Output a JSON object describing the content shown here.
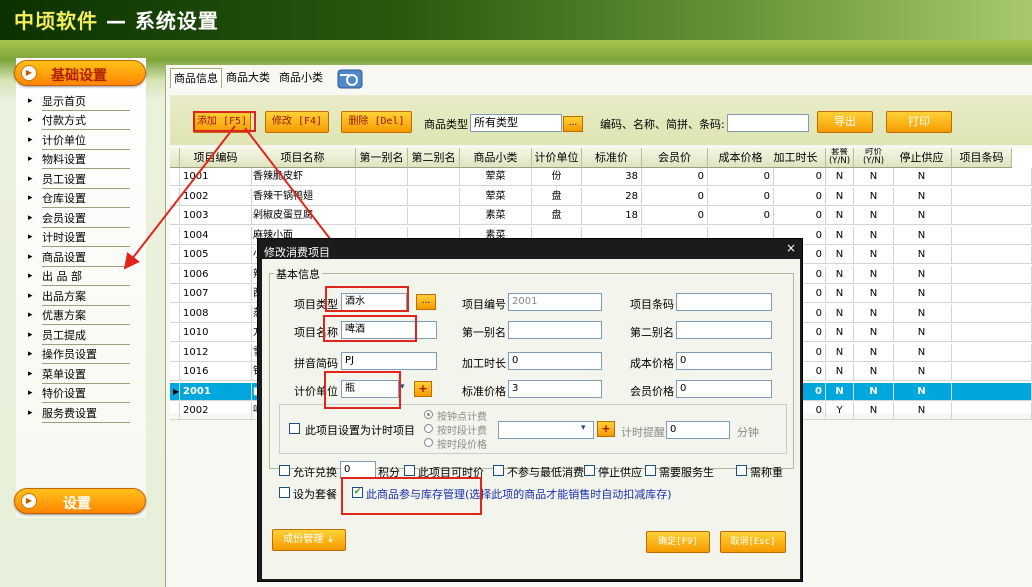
{
  "app": {
    "title_part1": "中顷软件",
    "title_part2": " — 系统设置"
  },
  "sidebar": {
    "header": "基础设置",
    "items": [
      "显示首页",
      "付款方式",
      "计价单位",
      "物料设置",
      "员工设置",
      "仓库设置",
      "会员设置",
      "计时设置",
      "商品设置",
      "出 品 部",
      "出品方案",
      "优惠方案",
      "员工提成",
      "操作员设置",
      "菜单设置",
      "特价设置",
      "服务费设置"
    ],
    "footer": "设置"
  },
  "tabs": [
    "商品信息",
    "商品大类",
    "商品小类"
  ],
  "toolbar": {
    "add": "添加 [F5]",
    "edit": "修改 [F4]",
    "delete": "删除 [Del]",
    "type_label": "商品类型",
    "type_value": "所有类型",
    "dots": "...",
    "search_label": "编码、名称、简拼、条码:",
    "search_value": "",
    "export": "导出",
    "print": "打印"
  },
  "grid": {
    "headers": [
      "项目编码",
      "项目名称",
      "第一别名",
      "第二别名",
      "商品小类",
      "计价单位",
      "标准价",
      "会员价",
      "成本价格",
      "加工时长",
      "套餐 (Y/N)",
      "时价 (Y/N)",
      "停止供应",
      "项目条码"
    ],
    "rows": [
      {
        "code": "1001",
        "name": "香辣脆皮虾",
        "a1": "",
        "a2": "",
        "sub": "荤菜",
        "unit": "份",
        "price": "38",
        "mprice": "0",
        "cost": "0",
        "time": "0",
        "combo": "N",
        "tprice": "N",
        "stop": "N"
      },
      {
        "code": "1002",
        "name": "香辣干锅鸭翅",
        "a1": "",
        "a2": "",
        "sub": "荤菜",
        "unit": "盘",
        "price": "28",
        "mprice": "0",
        "cost": "0",
        "time": "0",
        "combo": "N",
        "tprice": "N",
        "stop": "N"
      },
      {
        "code": "1003",
        "name": "剁椒皮蛋豆腐",
        "a1": "",
        "a2": "",
        "sub": "素菜",
        "unit": "盘",
        "price": "18",
        "mprice": "0",
        "cost": "0",
        "time": "0",
        "combo": "N",
        "tprice": "N",
        "stop": "N"
      },
      {
        "code": "1004",
        "name": "麻辣小面",
        "a1": "",
        "a2": "",
        "sub": "素菜",
        "unit": "",
        "price": "",
        "mprice": "",
        "cost": "",
        "time": "0",
        "combo": "N",
        "tprice": "N",
        "stop": "N"
      },
      {
        "code": "1005",
        "name": "小",
        "a1": "",
        "a2": "",
        "sub": "",
        "unit": "",
        "price": "",
        "mprice": "",
        "cost": "",
        "time": "0",
        "combo": "N",
        "tprice": "N",
        "stop": "N"
      },
      {
        "code": "1006",
        "name": "辣",
        "a1": "",
        "a2": "",
        "sub": "",
        "unit": "",
        "price": "",
        "mprice": "",
        "cost": "",
        "time": "0",
        "combo": "N",
        "tprice": "N",
        "stop": "N"
      },
      {
        "code": "1007",
        "name": "西",
        "a1": "",
        "a2": "",
        "sub": "",
        "unit": "",
        "price": "",
        "mprice": "",
        "cost": "",
        "time": "0",
        "combo": "N",
        "tprice": "N",
        "stop": "N"
      },
      {
        "code": "1008",
        "name": "蒸",
        "a1": "",
        "a2": "",
        "sub": "",
        "unit": "",
        "price": "",
        "mprice": "",
        "cost": "",
        "time": "0",
        "combo": "N",
        "tprice": "N",
        "stop": "N"
      },
      {
        "code": "1010",
        "name": "方",
        "a1": "",
        "a2": "",
        "sub": "",
        "unit": "",
        "price": "",
        "mprice": "",
        "cost": "",
        "time": "0",
        "combo": "N",
        "tprice": "N",
        "stop": "N"
      },
      {
        "code": "1012",
        "name": "雪",
        "a1": "",
        "a2": "",
        "sub": "",
        "unit": "",
        "price": "",
        "mprice": "",
        "cost": "",
        "time": "0",
        "combo": "N",
        "tprice": "N",
        "stop": "N"
      },
      {
        "code": "1016",
        "name": "铁",
        "a1": "",
        "a2": "",
        "sub": "",
        "unit": "",
        "price": "",
        "mprice": "",
        "cost": "",
        "time": "0",
        "combo": "N",
        "tprice": "N",
        "stop": "N"
      },
      {
        "code": "2001",
        "name": "■",
        "a1": "",
        "a2": "",
        "sub": "",
        "unit": "",
        "price": "",
        "mprice": "",
        "cost": "",
        "time": "0",
        "combo": "N",
        "tprice": "N",
        "stop": "N"
      },
      {
        "code": "2002",
        "name": "啤",
        "a1": "",
        "a2": "",
        "sub": "",
        "unit": "",
        "price": "",
        "mprice": "",
        "cost": "",
        "time": "0",
        "combo": "Y",
        "tprice": "N",
        "stop": "N"
      }
    ]
  },
  "dialog": {
    "title": "修改消费项目",
    "close": "×",
    "group": "基本信息",
    "type_label": "项目类型",
    "type_value": "酒水",
    "code_label": "项目编号",
    "code_value": "2001",
    "barcode_label": "项目条码",
    "barcode_value": "",
    "name_label": "项目名称",
    "name_value": "啤酒",
    "alias1_label": "第一别名",
    "alias1_value": "",
    "alias2_label": "第二别名",
    "alias2_value": "",
    "pinyin_label": "拼音简码",
    "pinyin_value": "PJ",
    "proc_label": "加工时长",
    "proc_value": "0",
    "cost_label": "成本价格",
    "cost_value": "0",
    "unit_label": "计价单位",
    "unit_value": "瓶",
    "std_label": "标准价格",
    "std_value": "3",
    "member_label": "会员价格",
    "member_value": "0",
    "timer_check": "此项目设置为计时项目",
    "radio1": "按钟点计费",
    "radio2": "按时段计费",
    "radio3": "按时段价格",
    "remind_label": "计时提醒",
    "remind_value": "0",
    "minutes": "分钟",
    "exchange_label": "允许兑换",
    "exchange_value": "0",
    "points": "积分",
    "opt_timeprice": "此项目可时价",
    "opt_nomin": "不参与最低消费",
    "opt_stop": "停止供应",
    "opt_service": "需要服务生",
    "opt_weigh": "需称重",
    "opt_combo": "设为套餐",
    "opt_stock": "此商品参与库存管理(选择此项的商品才能销售时自动扣减库存)",
    "recipe": "成份管理 ↓",
    "ok": "确定[F9]",
    "cancel": "取消[Esc]"
  }
}
